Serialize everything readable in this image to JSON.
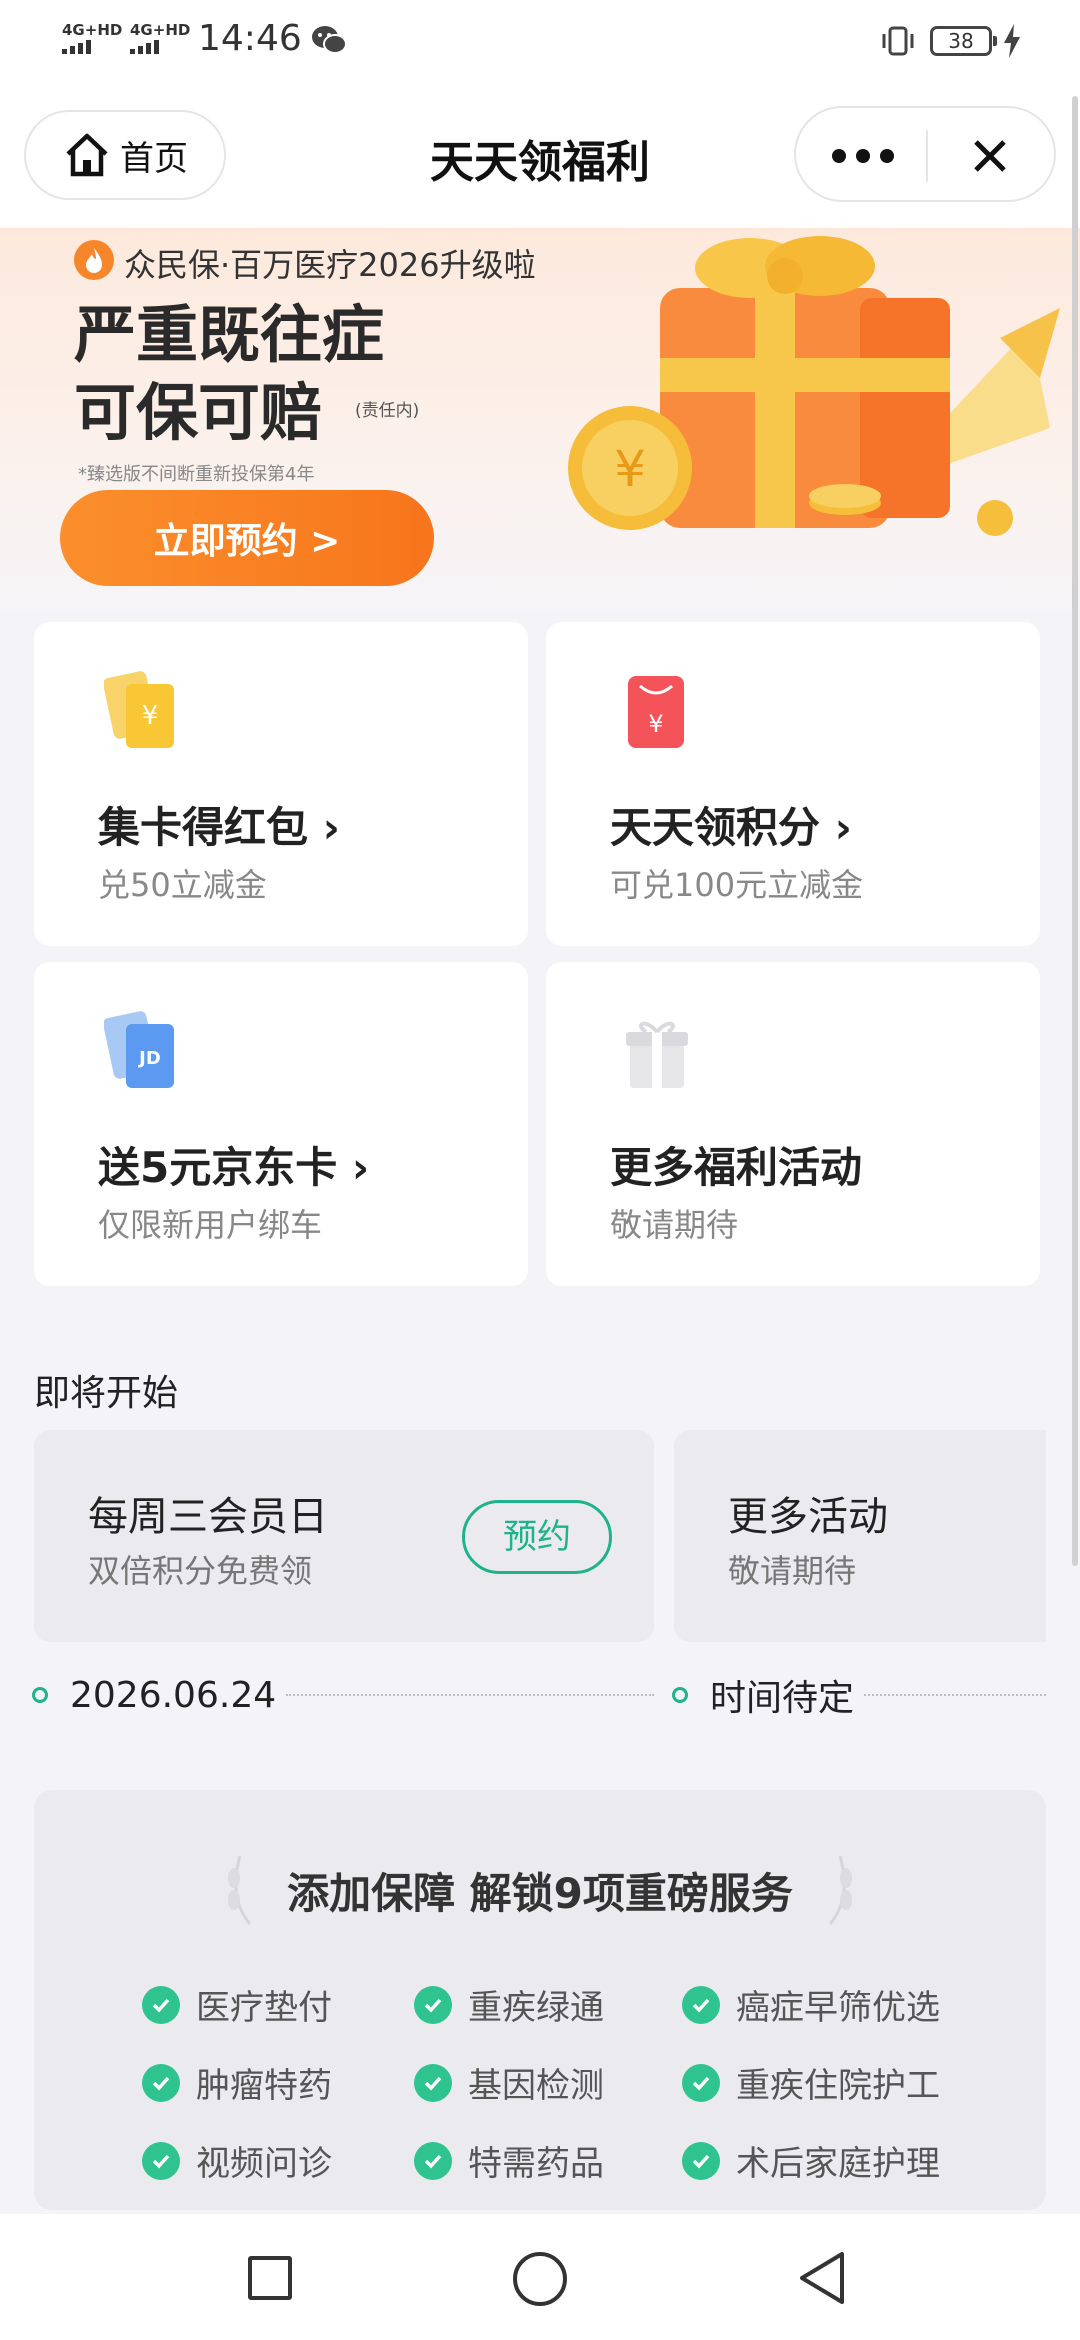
{
  "status": {
    "time": "14:46",
    "signal1": "4G+HD",
    "signal2": "4G+HD",
    "battery": "38"
  },
  "nav": {
    "home_label": "首页",
    "title": "天天领福利"
  },
  "banner": {
    "subtitle": "众民保·百万医疗2026升级啦",
    "headline1": "严重既往症",
    "headline2": "可保可赔",
    "note": "(责任内)",
    "footnote": "*臻选版不间断重新投保第4年",
    "cta": "立即预约 >"
  },
  "cards": [
    {
      "title": "集卡得红包 ›",
      "desc": "兑50立减金",
      "icon": "yellow-card-icon"
    },
    {
      "title": "天天领积分 ›",
      "desc": "可兑100元立减金",
      "icon": "red-envelope-icon"
    },
    {
      "title": "送5元京东卡 ›",
      "desc": "仅限新用户绑车",
      "icon": "jd-card-icon"
    },
    {
      "title": "更多福利活动",
      "desc": "敬请期待",
      "icon": "gift-icon"
    }
  ],
  "upcoming": {
    "title": "即将开始",
    "events": [
      {
        "title": "每周三会员日",
        "desc": "双倍积分免费领",
        "button": "预约",
        "date": "2026.06.24"
      },
      {
        "title": "更多活动",
        "desc": "敬请期待",
        "date": "时间待定"
      }
    ]
  },
  "features": {
    "title": "添加保障 解锁9项重磅服务",
    "items": [
      "医疗垫付",
      "重疾绿通",
      "癌症早筛优选",
      "肿瘤特药",
      "基因检测",
      "重疾住院护工",
      "视频问诊",
      "特需药品",
      "术后家庭护理"
    ]
  },
  "colors": {
    "accent_green": "#1eb38a",
    "cta_orange": "#f7751c",
    "check_green": "#2ec38f"
  }
}
